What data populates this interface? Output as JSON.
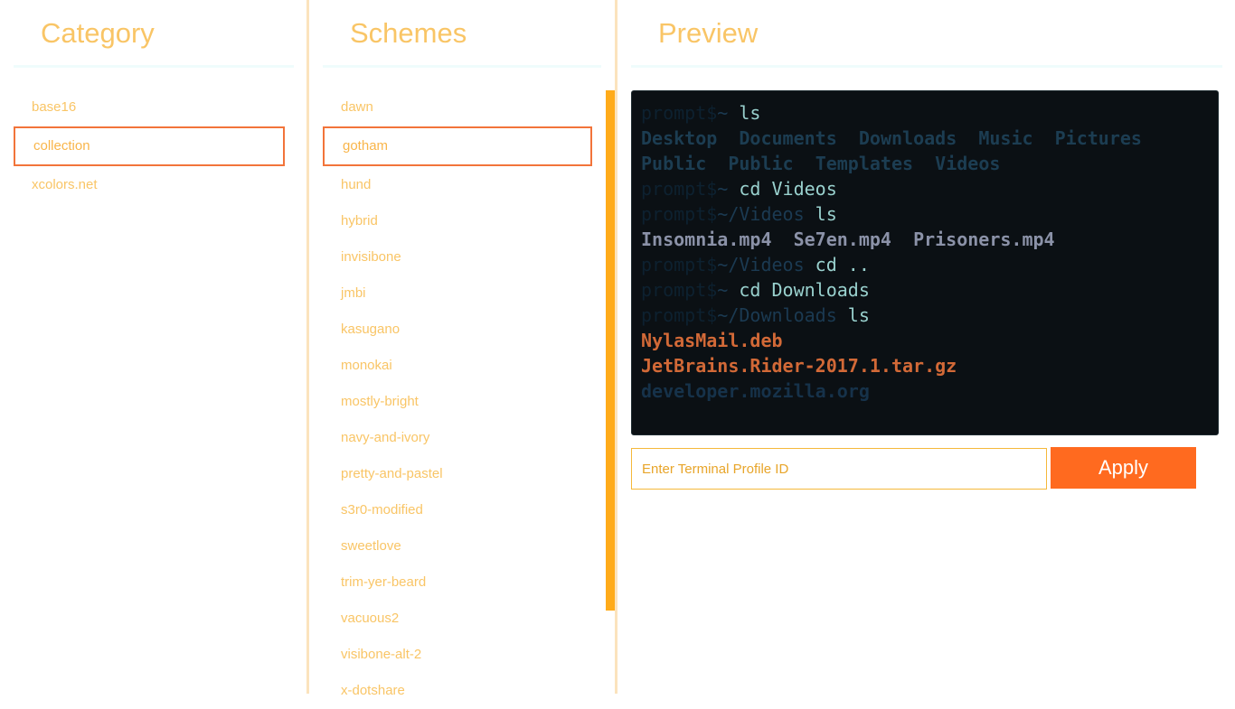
{
  "category": {
    "title": "Category",
    "items": [
      "base16",
      "collection",
      "xcolors.net"
    ],
    "selected_index": 1
  },
  "schemes": {
    "title": "Schemes",
    "items": [
      "dawn",
      "gotham",
      "hund",
      "hybrid",
      "invisibone",
      "jmbi",
      "kasugano",
      "monokai",
      "mostly-bright",
      "navy-and-ivory",
      "pretty-and-pastel",
      "s3r0-modified",
      "sweetlove",
      "trim-yer-beard",
      "vacuous2",
      "visibone-alt-2",
      "x-dotshare"
    ],
    "selected_index": 1
  },
  "preview": {
    "title": "Preview",
    "terminal": {
      "prompt": "prompt$",
      "lines": {
        "l1_path": "~",
        "l1_cmd": " ls",
        "l2": [
          "Desktop",
          "Documents",
          "Downloads",
          "Music",
          "Pictures"
        ],
        "l3": [
          "Public",
          "Public",
          "Templates",
          "Videos"
        ],
        "l4_path": "~",
        "l4_cmd": " cd Videos",
        "l5_path": "~/Videos",
        "l5_cmd": " ls",
        "l6": [
          "Insomnia.mp4",
          "Se7en.mp4",
          "Prisoners.mp4"
        ],
        "l7_path": "~/Videos",
        "l7_cmd": " cd ..",
        "l8_path": "~",
        "l8_cmd": " cd Downloads",
        "l9_path": "~/Downloads",
        "l9_cmd": " ls",
        "l10": "NylasMail.deb",
        "l11": "JetBrains.Rider-2017.1.tar.gz",
        "l12": "developer.mozilla.org"
      }
    },
    "profile_input": {
      "placeholder": "Enter Terminal Profile ID",
      "value": ""
    },
    "apply_label": "Apply"
  },
  "colors": {
    "accent": "#f9c566",
    "selection_border": "#f2743a",
    "button": "#ff6a1f",
    "scrollbar": "#ffab1a",
    "terminal_bg": "#0b1014"
  }
}
